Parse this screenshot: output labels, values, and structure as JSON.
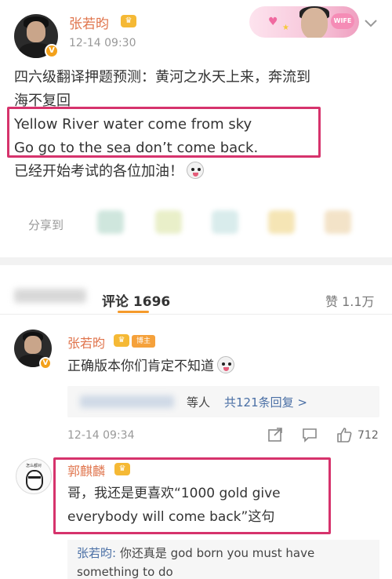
{
  "post": {
    "author": "张若昀",
    "time": "12-14 09:30",
    "text_lines": [
      "四六级翻译押题预测：黄河之水天上来，奔流到",
      "海不复回"
    ],
    "english_lines": [
      "Yellow River water come from sky",
      "Go go to the sea don’t come back."
    ],
    "closing": "已经开始考试的各位加油！",
    "share_label": "分享到"
  },
  "comments_header": {
    "comments_tab": "评论 1696",
    "likes_tab": "赞 1.1万"
  },
  "comments": [
    {
      "author": "张若昀",
      "badge": "博主",
      "text": "正确版本你们肯定不知道",
      "reply_wait": "等人",
      "reply_count": "共121条回复 >",
      "time": "12-14 09:34",
      "likes": "712"
    },
    {
      "author": "郭麒麟",
      "text_lines": [
        "哥，我还是更喜欢“1000 gold give",
        "everybody will come back”这句"
      ],
      "avatar_caption": "怎么都对",
      "reply": {
        "author": "张若昀:",
        "lines": [
          " 你还真是 god born you must have",
          "something to do"
        ]
      }
    }
  ],
  "banner": {
    "badge": "WIFE"
  },
  "icons": {
    "verified": "verified-v-icon",
    "crown": "crown-icon",
    "share": "share-icon",
    "comment": "comment-icon",
    "like": "thumbs-up-icon",
    "more": "chevron-down-icon"
  },
  "colors": {
    "username": "#e0754d",
    "highlight": "#d6336c",
    "link": "#4a6fa5",
    "tab_underline": "#f59a2b"
  }
}
